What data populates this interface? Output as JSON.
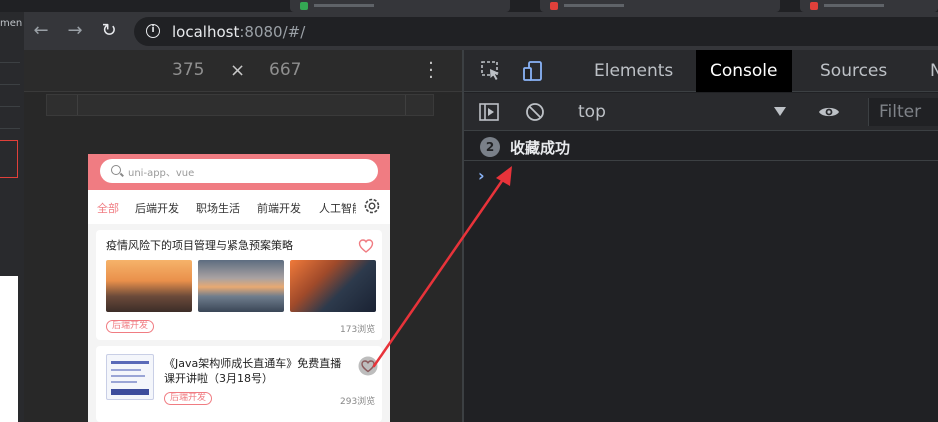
{
  "browser": {
    "url_host": "localhost",
    "url_rest": ":8080/#/"
  },
  "left_window": {
    "fragment": "men"
  },
  "device_toolbar": {
    "width": "375",
    "times": "×",
    "height": "667"
  },
  "phone": {
    "search_placeholder": "uni-app、vue",
    "categories": [
      "全部",
      "后端开发",
      "职场生活",
      "前端开发",
      "人工智能"
    ],
    "cards": [
      {
        "title": "疫情风险下的项目管理与紧急预案策略",
        "tag": "后端开发",
        "views": "173浏览"
      },
      {
        "title_line1": "《Java架构师成长直通车》免费直播",
        "title_line2": "课开讲啦（3月18号）",
        "tag": "后端开发",
        "views": "293浏览"
      }
    ]
  },
  "devtools": {
    "tabs": [
      "Elements",
      "Console",
      "Sources",
      "N"
    ],
    "active_tab": "Console",
    "context": "top",
    "filter_placeholder": "Filter",
    "log_count": "2",
    "log_message": "收藏成功",
    "prompt": "›"
  },
  "colors": {
    "accent": "#f07c82",
    "arrow": "#e8333a"
  }
}
